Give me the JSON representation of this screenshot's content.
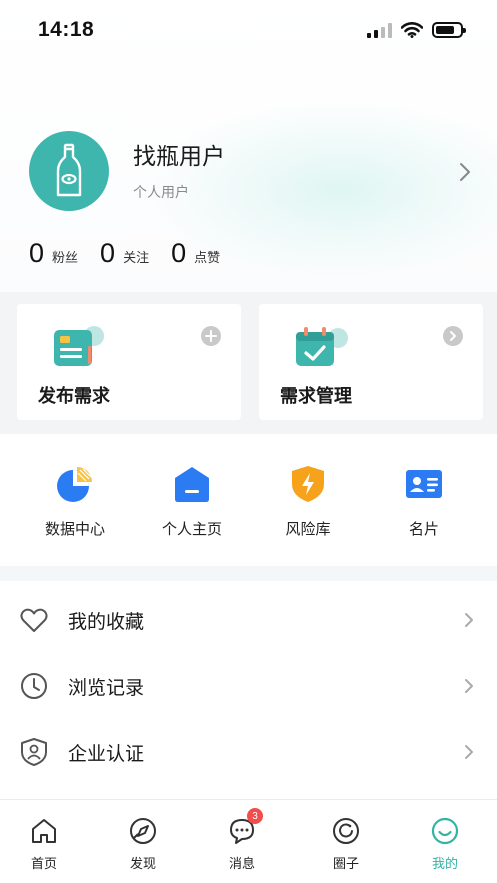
{
  "status_bar": {
    "time": "14:18"
  },
  "profile": {
    "name": "找瓶用户",
    "type": "个人用户",
    "stats": [
      {
        "value": "0",
        "label": "粉丝"
      },
      {
        "value": "0",
        "label": "关注"
      },
      {
        "value": "0",
        "label": "点赞"
      }
    ]
  },
  "quick_actions": [
    {
      "label": "发布需求",
      "icon": "document-card-icon",
      "corner": "plus-icon"
    },
    {
      "label": "需求管理",
      "icon": "calendar-check-icon",
      "corner": "chevron-right-icon"
    }
  ],
  "grid": [
    {
      "label": "数据中心",
      "icon": "pie-chart-icon"
    },
    {
      "label": "个人主页",
      "icon": "home-icon"
    },
    {
      "label": "风险库",
      "icon": "shield-bolt-icon"
    },
    {
      "label": "名片",
      "icon": "id-card-icon"
    }
  ],
  "menu": [
    {
      "label": "我的收藏",
      "icon": "heart-icon"
    },
    {
      "label": "浏览记录",
      "icon": "clock-icon"
    },
    {
      "label": "企业认证",
      "icon": "shield-user-icon"
    }
  ],
  "tab_bar": {
    "tabs": [
      {
        "label": "首页",
        "icon": "home-outline-icon"
      },
      {
        "label": "发现",
        "icon": "compass-icon"
      },
      {
        "label": "消息",
        "icon": "chat-bubble-icon",
        "badge": "3"
      },
      {
        "label": "圈子",
        "icon": "circle-refresh-icon"
      },
      {
        "label": "我的",
        "icon": "smile-icon",
        "active": true
      }
    ]
  },
  "colors": {
    "accent": "#33b3a6",
    "badge": "#f24d4d",
    "blue": "#2b7cf2",
    "orange": "#f6a21b"
  }
}
